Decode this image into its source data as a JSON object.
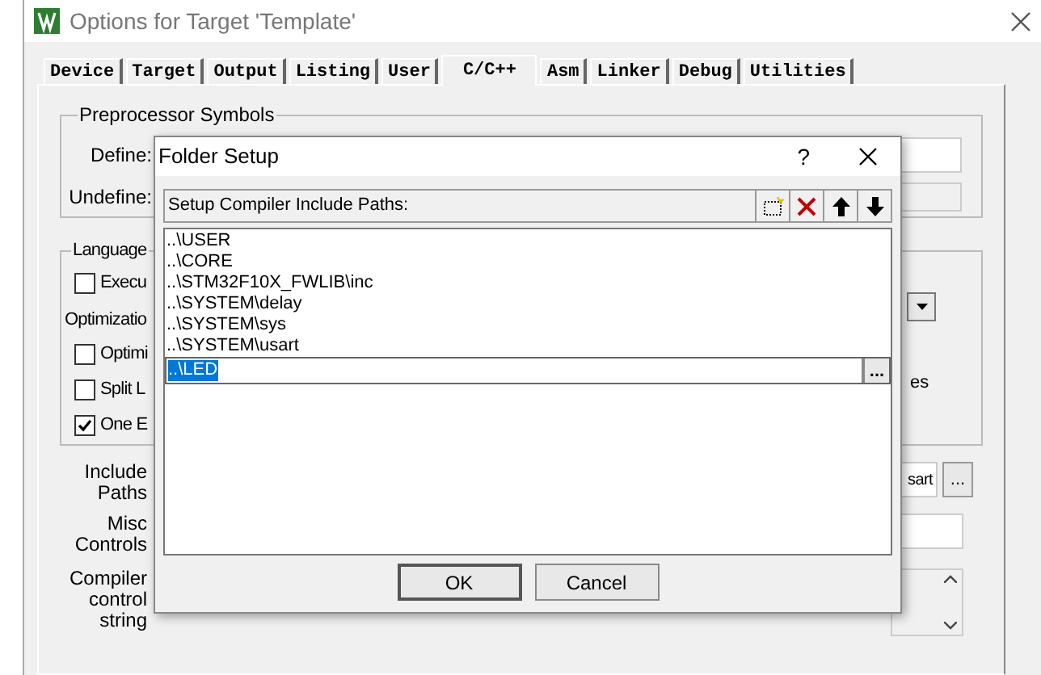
{
  "window": {
    "title": "Options for Target 'Template'"
  },
  "tabs": [
    {
      "label": "Device",
      "selected": false
    },
    {
      "label": "Target",
      "selected": false
    },
    {
      "label": "Output",
      "selected": false
    },
    {
      "label": "Listing",
      "selected": false
    },
    {
      "label": "User",
      "selected": false
    },
    {
      "label": "C/C++",
      "selected": true
    },
    {
      "label": "Asm",
      "selected": false
    },
    {
      "label": "Linker",
      "selected": false
    },
    {
      "label": "Debug",
      "selected": false
    },
    {
      "label": "Utilities",
      "selected": false
    }
  ],
  "preprocessor": {
    "title": "Preprocessor Symbols",
    "define_label": "Define:",
    "undefine_label": "Undefine:"
  },
  "language": {
    "title": "Language",
    "items": [
      {
        "kind": "checkbox",
        "label": "Execu",
        "checked": false
      },
      {
        "kind": "heading",
        "label": "Optimizatio"
      },
      {
        "kind": "checkbox",
        "label": "Optimi",
        "checked": false
      },
      {
        "kind": "checkbox",
        "label": "Split L",
        "checked": false
      },
      {
        "kind": "checkbox",
        "label": "One E",
        "checked": true
      }
    ],
    "right_text": "es"
  },
  "include": {
    "label": "Include Paths",
    "value": "sart",
    "button": "..."
  },
  "misc": {
    "label": "Misc Controls"
  },
  "compiler": {
    "label": "Compiler control string"
  },
  "folder_dialog": {
    "title": "Folder Setup",
    "help": "?",
    "header": "Setup Compiler Include Paths:",
    "paths": [
      "..\\USER",
      "..\\CORE",
      "..\\STM32F10X_FWLIB\\inc",
      "..\\SYSTEM\\delay",
      "..\\SYSTEM\\sys",
      "..\\SYSTEM\\usart"
    ],
    "editing": {
      "value": "..\\LED",
      "button": "..."
    },
    "buttons": [
      "OK",
      "Cancel"
    ]
  }
}
